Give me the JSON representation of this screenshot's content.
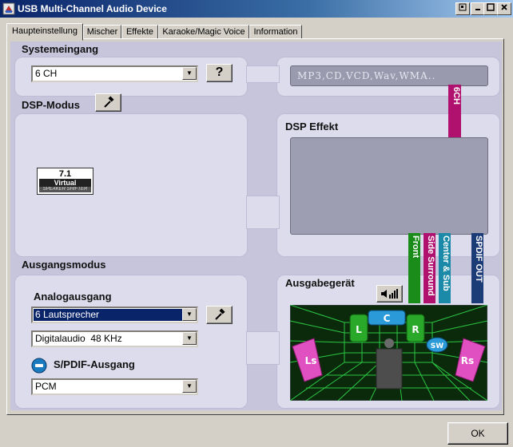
{
  "window": {
    "title": "USB Multi-Channel Audio Device"
  },
  "tabs": [
    {
      "label": "Haupteinstellung"
    },
    {
      "label": "Mischer"
    },
    {
      "label": "Effekte"
    },
    {
      "label": "Karaoke/Magic Voice"
    },
    {
      "label": "Information"
    }
  ],
  "system_input": {
    "label": "Systemeingang",
    "value": "6 CH",
    "help_label": "?",
    "display_text": "MP3,CD,VCD,Wav,WMA.."
  },
  "dsp_mode": {
    "label": "DSP-Modus",
    "badge_top": "7.1",
    "badge_mid": "Virtual",
    "badge_bottom": "SPEAKER SHIFTER"
  },
  "dsp_effect": {
    "label": "DSP Effekt",
    "channel_tag": "6CH"
  },
  "output_mode": {
    "label": "Ausgangsmodus",
    "analog_label": "Analogausgang",
    "analog_value": "6 Lautsprecher",
    "digital_value": "Digitalaudio  48 KHz",
    "spdif_label": "S/PDIF-Ausgang",
    "spdif_value": "PCM"
  },
  "output_device": {
    "label": "Ausgabegerät",
    "bars": [
      {
        "label": "Front",
        "color": "#1a8c1a"
      },
      {
        "label": "Side Surround",
        "color": "#b0106e"
      },
      {
        "label": "Center & Sub",
        "color": "#1a8aa8"
      },
      {
        "label": "SPDIF OUT",
        "color": "#1c3c78"
      }
    ],
    "speakers": {
      "ls": "Ls",
      "l": "L",
      "c": "C",
      "r": "R",
      "sw": "SW",
      "rs": "Rs"
    }
  },
  "ok_label": "OK"
}
